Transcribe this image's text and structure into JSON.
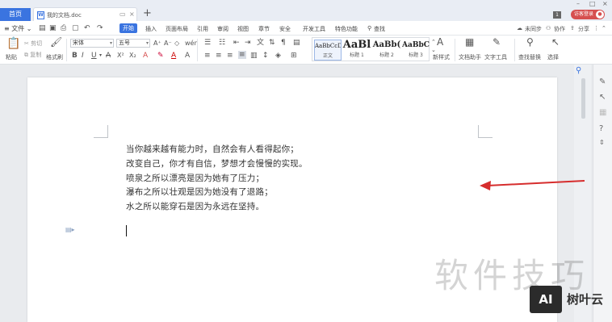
{
  "titlebar": {
    "home_tab": "首页",
    "doc_tab": "我的文档.doc",
    "doc_icon": "W",
    "new_tab": "+",
    "count_badge": "1",
    "login_label": "访客登录",
    "window_controls": [
      "–",
      "□",
      "×"
    ]
  },
  "menubar": {
    "file_label": "≡ 文件 ⌄",
    "start_label": "开始",
    "items": [
      "插入",
      "页面布局",
      "引用",
      "审阅",
      "视图",
      "章节",
      "安全",
      "开发工具",
      "特色功能"
    ],
    "search_label": "查找",
    "sync_label": "未同步",
    "collab_label": "协作",
    "share_label": "分享"
  },
  "ribbon": {
    "paste_label": "粘贴",
    "cut_label": "剪切",
    "copy_label": "复制",
    "format_painter_label": "格式刷",
    "font_name": "宋体",
    "font_size": "五号",
    "styles": [
      {
        "preview": "AaBbCcDd",
        "label": "正文"
      },
      {
        "preview": "AaBl",
        "label": "标题 1"
      },
      {
        "preview": "AaBb(",
        "label": "标题 2"
      },
      {
        "preview": "AaBbC",
        "label": "标题 3"
      }
    ],
    "new_style_label": "新样式",
    "doc_assistant_label": "文档助手",
    "text_tools_label": "文字工具",
    "find_replace_label": "查找替换",
    "select_label": "选择"
  },
  "document": {
    "lines": [
      "当你越来越有能力时，自然会有人看得起你；",
      "改变自己，你才有自信，梦想才会慢慢的实现。",
      "喷泉之所以漂亮是因为她有了压力；",
      "瀑布之所以壮观是因为她没有了退路；",
      "水之所以能穿石是因为永远在坚持。"
    ]
  },
  "watermark": {
    "text": "软件技巧",
    "badge": "AI",
    "brand": "树叶云"
  },
  "colors": {
    "accent": "#3a74e0",
    "login": "#d64f4f",
    "arrow": "#d62d2d"
  }
}
